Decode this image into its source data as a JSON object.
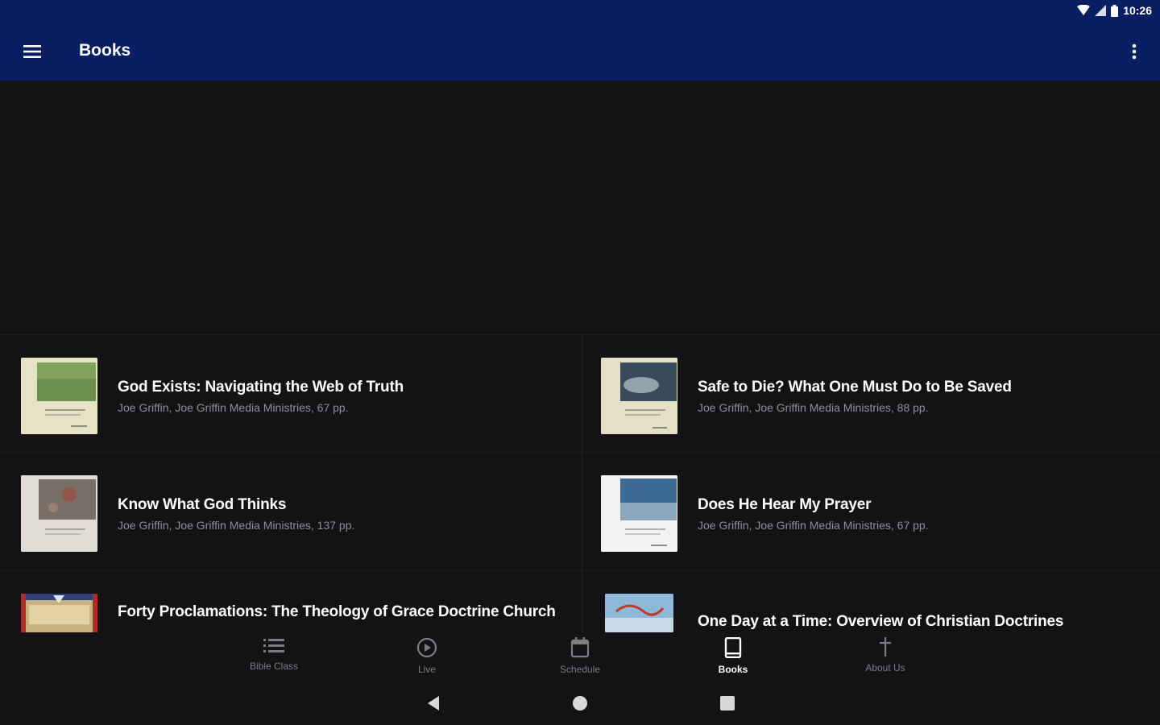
{
  "status_bar": {
    "time": "10:26"
  },
  "app_bar": {
    "title": "Books"
  },
  "books": [
    {
      "title": "God Exists: Navigating the Web of Truth",
      "meta": "Joe Griffin, Joe Griffin Media Ministries, 67 pp."
    },
    {
      "title": "Safe to Die? What One Must Do to Be Saved",
      "meta": "Joe Griffin, Joe Griffin Media Ministries, 88 pp."
    },
    {
      "title": "Know What God Thinks",
      "meta": "Joe Griffin, Joe Griffin Media Ministries, 137 pp."
    },
    {
      "title": "Does He Hear My Prayer",
      "meta": "Joe Griffin, Joe Griffin Media Ministries, 67 pp."
    },
    {
      "title": "Forty Proclamations: The Theology of Grace Doctrine Church",
      "meta": ""
    },
    {
      "title": "One Day at a Time: Overview of Christian Doctrines",
      "meta": ""
    }
  ],
  "bottom_nav": [
    {
      "label": "Bible Class",
      "icon": "list-icon",
      "active": false
    },
    {
      "label": "Live",
      "icon": "play-circle-icon",
      "active": false
    },
    {
      "label": "Schedule",
      "icon": "calendar-icon",
      "active": false
    },
    {
      "label": "Books",
      "icon": "book-icon",
      "active": true
    },
    {
      "label": "About Us",
      "icon": "cross-icon",
      "active": false
    }
  ],
  "colors": {
    "app_bar": "#0a1f63",
    "background": "#131316",
    "meta_text": "#8d8f95",
    "nav_inactive": "#7b7d83"
  }
}
